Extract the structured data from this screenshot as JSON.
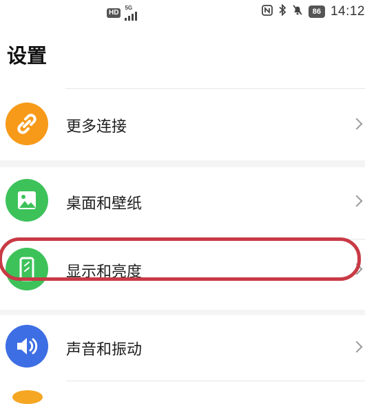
{
  "status_bar": {
    "hd_label": "HD",
    "network_label": "5G",
    "battery_level": "86",
    "time": "14:12",
    "icons": [
      "hd-icon",
      "signal-5g-icon",
      "nfc-icon",
      "bluetooth-icon",
      "mute-bell-icon",
      "battery-icon"
    ]
  },
  "page": {
    "title": "设置"
  },
  "items": [
    {
      "label": "更多连接",
      "icon": "link-icon",
      "color": "#f79a19"
    },
    {
      "label": "桌面和壁纸",
      "icon": "wallpaper-icon",
      "color": "#3dc25a"
    },
    {
      "label": "显示和亮度",
      "icon": "phone-display-icon",
      "color": "#3dc25a",
      "highlighted": true
    },
    {
      "label": "声音和振动",
      "icon": "speaker-icon",
      "color": "#3d6ee4"
    }
  ],
  "colors": {
    "highlight": "#c83a45",
    "background": "#ffffff",
    "group_gap": "#f4f4f4"
  }
}
